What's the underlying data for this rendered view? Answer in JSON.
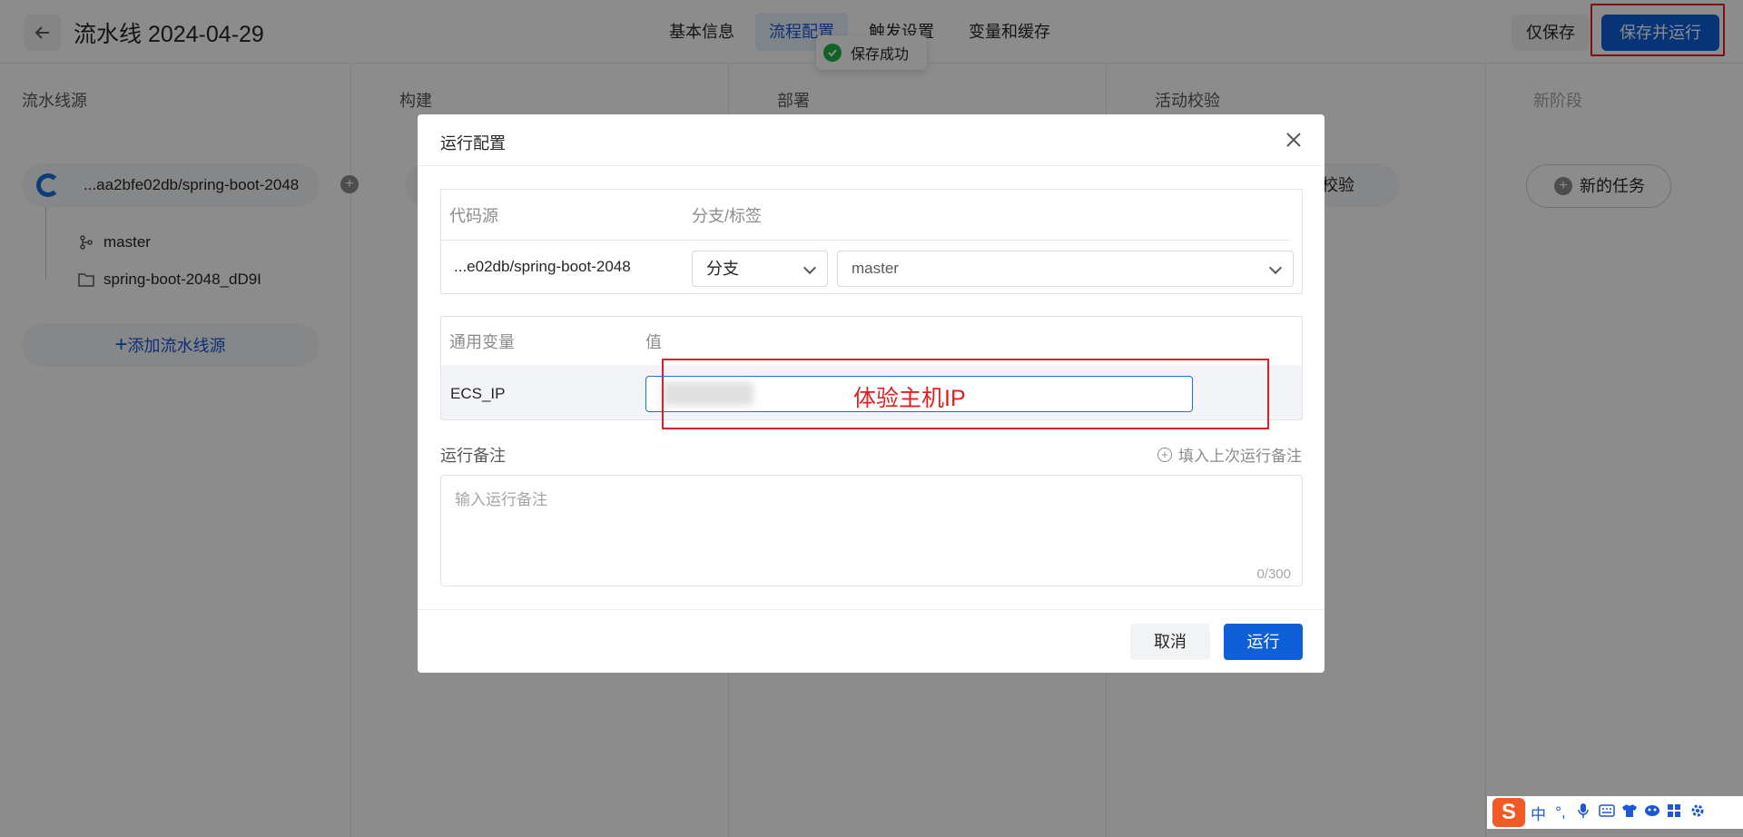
{
  "header": {
    "title": "流水线 2024-04-29",
    "tabs": [
      {
        "label": "基本信息"
      },
      {
        "label": "流程配置"
      },
      {
        "label": "触发设置"
      },
      {
        "label": "变量和缓存"
      }
    ],
    "save_only": "仅保存",
    "save_and_run": "保存并运行",
    "toast": "保存成功"
  },
  "stages": {
    "source_title": "流水线源",
    "build_title": "构建",
    "deploy_title": "部署",
    "check_title": "活动校验",
    "new_stage_title": "新阶段",
    "source_name": "...aa2bfe02db/spring-boot-2048",
    "branch": "master",
    "folder": "spring-boot-2048_dD9I",
    "add_source": "添加流水线源",
    "check_card": "校验",
    "new_task": "新的任务"
  },
  "modal": {
    "title": "运行配置",
    "col_source": "代码源",
    "col_branch": "分支/标签",
    "source_value": "...e02db/spring-boot-2048",
    "branch_type": "分支",
    "branch_value": "master",
    "col_var": "通用变量",
    "col_value": "值",
    "var_name": "ECS_IP",
    "annotation": "体验主机IP",
    "note_label": "运行备注",
    "note_fill": "填入上次运行备注",
    "note_placeholder": "输入运行备注",
    "note_count": "0/300",
    "cancel": "取消",
    "run": "运行"
  },
  "ime": {
    "logo": "S",
    "mode": "中",
    "punct": "°,"
  },
  "colors": {
    "primary": "#0e5fd8",
    "highlight": "#e02020",
    "success": "#22b14c"
  }
}
